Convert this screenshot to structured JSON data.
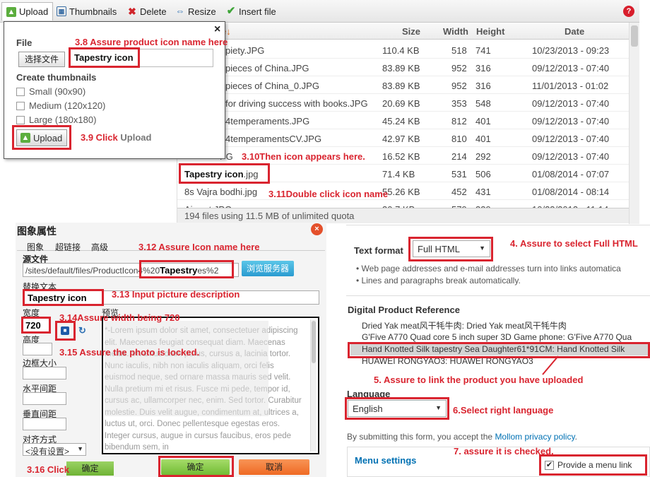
{
  "toolbar": {
    "upload": "Upload",
    "thumbnails": "Thumbnails",
    "delete": "Delete",
    "resize": "Resize",
    "insert_file": "Insert file",
    "help": "?"
  },
  "file_table": {
    "headers": {
      "name": "e↓",
      "size": "Size",
      "width": "Width",
      "height": "Height",
      "date": "Date"
    },
    "rows": [
      {
        "name": "piety.JPG",
        "size": "110.4 KB",
        "width": "518",
        "height": "741",
        "date": "10/23/2013 - 09:23"
      },
      {
        "name": "pieces of China.JPG",
        "size": "83.89 KB",
        "width": "952",
        "height": "316",
        "date": "09/12/2013 - 07:40"
      },
      {
        "name": "pieces of China_0.JPG",
        "size": "83.89 KB",
        "width": "952",
        "height": "316",
        "date": "11/01/2013 - 01:02"
      },
      {
        "name": "for driving success with books.JPG",
        "size": "20.69 KB",
        "width": "353",
        "height": "548",
        "date": "09/12/2013 - 07:40"
      },
      {
        "name": "4temperaments.JPG",
        "size": "45.24 KB",
        "width": "812",
        "height": "401",
        "date": "09/12/2013 - 07:40"
      },
      {
        "name": "4temperamentsCV.JPG",
        "size": "42.97 KB",
        "width": "810",
        "height": "401",
        "date": "09/12/2013 - 07:40"
      },
      {
        "name": "PG",
        "size": "16.52 KB",
        "width": "214",
        "height": "292",
        "date": "09/12/2013 - 07:40"
      },
      {
        "name_bold": "Tapestry icon",
        "name_rest": ".jpg",
        "size": "71.4 KB",
        "width": "531",
        "height": "506",
        "date": "01/08/2014 - 07:07"
      },
      {
        "name": "8s Vajra bodhi.jpg",
        "size": "55.26 KB",
        "width": "452",
        "height": "431",
        "date": "01/08/2014 - 08:14"
      },
      {
        "name": "Airport.JPG",
        "size": "30.7 KB",
        "width": "579",
        "height": "339",
        "date": "10/23/2013 - 11:14"
      }
    ],
    "quota": "194 files using 11.5 MB of unlimited quota"
  },
  "upload_popup": {
    "file_label": "File",
    "choose_file": "选择文件",
    "file_name": "Tapestry icon",
    "thumbs_label": "Create thumbnails",
    "thumbs": [
      "Small (90x90)",
      "Medium (120x120)",
      "Large (180x180)"
    ],
    "upload_button": "Upload",
    "close": "×"
  },
  "image_dialog": {
    "title": "图象属性",
    "tabs": [
      "图象",
      "超链接",
      "高级"
    ],
    "source_label": "源文件",
    "source_value_prefix": "/sites/default/files/ProductIcon",
    "source_value_mid": "4%20",
    "source_value_bold": "Tapestry",
    "source_value_tail": "es%2",
    "browse_server": "浏览服务器",
    "alt_label": "替换文本",
    "alt_value": "Tapestry icon",
    "width_label": "宽度",
    "width_value": "720",
    "preview_label": "预览",
    "height_label": "高度",
    "border_label": "边框大小",
    "hspace_label": "水平间距",
    "vspace_label": "垂直间距",
    "align_label": "对齐方式",
    "align_value": "<没有设置>",
    "preview_text": "*-Lorem ipsum dolor sit amet, consectetuer adipiscing elit. Maecenas feugiat consequat diam. Maecenas metus. Vivamus diam purus, cursus a, lacinia tortor. Nunc iaculis, nibh non iaculis aliquam, orci felis euismod neque, sed ornare massa mauris sed velit. Nulla pretium mi et risus. Fusce mi pede, tempor id, cursus ac, ullamcorper nec, enim. Sed tortor. Curabitur molestie. Duis velit augue, condimentum at, ultrices a, luctus ut, orci. Donec pellentesque egestas eros. Integer cursus, augue in cursus faucibus, eros pede bibendum sem, in",
    "ok_small": "确定",
    "ok": "确定",
    "cancel": "取消"
  },
  "right_form": {
    "text_format_label": "Text format",
    "text_format_value": "Full HTML",
    "tips": [
      "Web page addresses and e-mail addresses turn into links automatica",
      "Lines and paragraphs break automatically."
    ],
    "digital_ref_label": "Digital Product Reference",
    "digital_options": [
      "Dried Yak meat风干牦牛肉: Dried Yak meat风干牦牛肉",
      "G'Five A770 Quad core 5 inch super 3D Game phone: G'Five A770 Qua",
      "Hand Knotted Silk tapestry Sea Daughter61*91CM: Hand Knotted Silk",
      "HUAWEI RONGYAO3: HUAWEI RONGYAO3"
    ],
    "language_label": "Language",
    "language_value": "English",
    "submit_text_prefix": "By submitting this form, you accept the ",
    "mollom_link": "Mollom privacy policy",
    "submit_text_suffix": ".",
    "menu_settings": "Menu settings",
    "provide_menu_link": "Provide a menu link"
  },
  "annotations": {
    "a38": "3.8 Assure product icon name here",
    "a39_prefix": "3.9 Click ",
    "a39_grey": "Upload",
    "a310": "3.10Then icon appears here.",
    "a311": "3.11Double click icon name",
    "a312": "3.12 Assure Icon name here",
    "a313": "3.13 Input picture description",
    "a314": "3.14Assure width being 720",
    "a315": "3.15 Assure the photo is locked.",
    "a316": "3.16 Click",
    "a4": "4. Assure to select Full HTML",
    "a5": "5. Assure to link the product you have uploaded",
    "a6": "6.Select right language",
    "a7": "7. assure it is checked."
  },
  "colors": {
    "annotation_red": "#d9242f",
    "link_blue": "#0071b3",
    "ok_green": "#7ec13d",
    "cancel_orange": "#f0732a"
  }
}
